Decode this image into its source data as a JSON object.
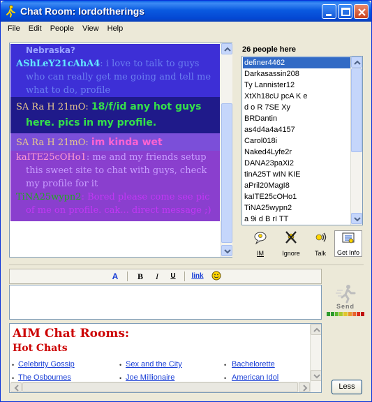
{
  "window": {
    "title": "Chat Room: lordoftherings",
    "minimize_icon": "minimize-icon",
    "maximize_icon": "maximize-icon",
    "close_icon": "close-icon"
  },
  "menu": [
    "File",
    "Edit",
    "People",
    "View",
    "Help"
  ],
  "chat": {
    "top_line": "Nebraska?",
    "messages": [
      {
        "sn": "AShLeY21cAhA4",
        "sep": ": ",
        "text": "i love to talk to guys who can really get me going and tell me what to do, profile"
      },
      {
        "sn": "SA Ra H 21mO",
        "sep": ": ",
        "text": "18/f/id any hot guys here. pics in my profile."
      },
      {
        "sn": "SA Ra H 21mO",
        "sep": ": ",
        "text": "im kinda wet"
      },
      {
        "sn": "kaITE25cOHo1",
        "sep": ": ",
        "text": "me and my friends setup this sweet site to chat with guys, check my profile for it"
      },
      {
        "sn": "TiNA25wypn2",
        "sep": ": ",
        "text": "Bored please come see pic of me on profile. cak... direct message ;)"
      }
    ]
  },
  "people": {
    "count_label": "26 people here",
    "list": [
      "definer4462",
      "Darkasassin208",
      "Ty Lannister12",
      "XtXh18cU pcA K e",
      "d o R 7SE Xy",
      "BRDantin",
      "as4d4a4a4157",
      "Carol018i",
      "Naked4Lyfe2r",
      "DANA23paXi2",
      "tinA25T wIN KIE",
      "aPril20MagI8",
      "kaITE25cOHo1",
      "TiNA25wypn2",
      "a 9i d B rI TT"
    ]
  },
  "actions": {
    "im": "IM",
    "ignore": "Ignore",
    "talk": "Talk",
    "getinfo": "Get Info"
  },
  "format": {
    "color": "A",
    "bold": "B",
    "italic": "I",
    "underline": "U",
    "link": "link",
    "smiley_icon": "smiley-icon"
  },
  "input": {
    "value": ""
  },
  "send_label": "Send",
  "ad": {
    "title": "AIM Chat Rooms:",
    "subtitle": "Hot Chats",
    "links": [
      "Celebrity Gossip",
      "Sex and the City",
      "Bachelorette",
      "The Osbournes",
      "Joe Millionaire",
      "American Idol"
    ]
  },
  "less_label": "Less",
  "colors": {
    "titlebar": "#0a5ae0",
    "selection": "#316ac5",
    "ad_red": "#cc0000",
    "link_blue": "#1a3fd6"
  }
}
